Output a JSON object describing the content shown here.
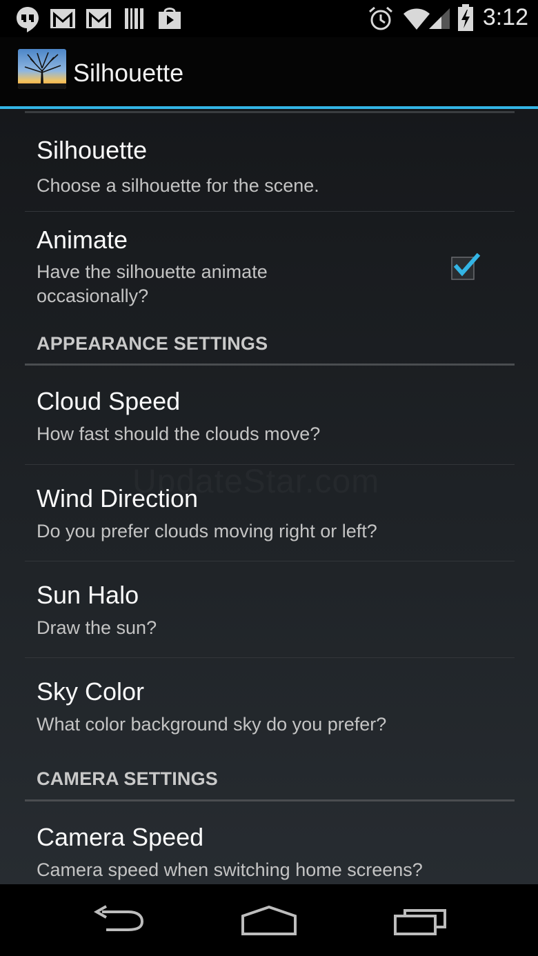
{
  "status_bar": {
    "time": "3:12",
    "left_icons": [
      "hangouts-icon",
      "gmail-icon",
      "gmail-icon",
      "barcode-icon",
      "shopping-bag-icon"
    ],
    "right_icons": [
      "alarm-icon",
      "wifi-icon",
      "signal-icon",
      "battery-icon"
    ]
  },
  "action_bar": {
    "title": "Silhouette",
    "icon": "tree-silhouette-app-icon"
  },
  "preferences": [
    {
      "title": "Silhouette",
      "summary": "Choose a silhouette for the scene."
    },
    {
      "title": "Animate",
      "summary": "Have the silhouette animate occasionally?",
      "checked": true
    }
  ],
  "appearance_category": {
    "title": "APPEARANCE SETTINGS",
    "items": [
      {
        "title": "Cloud Speed",
        "summary": "How fast should the clouds move?"
      },
      {
        "title": "Wind Direction",
        "summary": "Do you prefer clouds moving right or left?"
      },
      {
        "title": "Sun Halo",
        "summary": "Draw the sun?"
      },
      {
        "title": "Sky Color",
        "summary": "What color background sky do you prefer?"
      }
    ]
  },
  "camera_category": {
    "title": "CAMERA SETTINGS",
    "items": [
      {
        "title": "Camera Speed",
        "summary": "Camera speed when switching home screens?"
      }
    ]
  },
  "watermark": "UpdateStar.com",
  "nav_bar": {
    "buttons": [
      "back-icon",
      "home-icon",
      "recent-apps-icon"
    ]
  },
  "colors": {
    "accent": "#33b5e5",
    "background": "#1e2226"
  }
}
